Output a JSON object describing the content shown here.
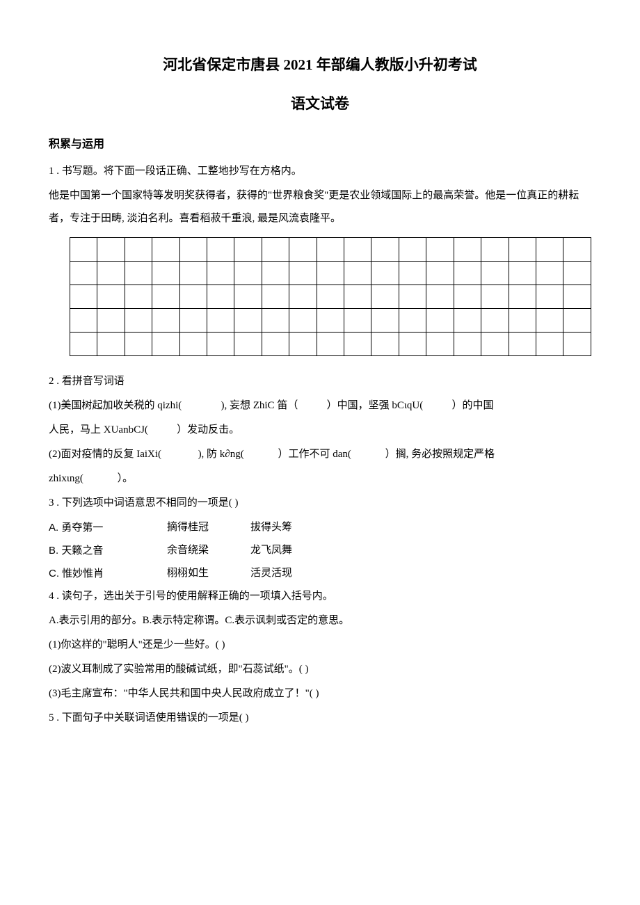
{
  "title": "河北省保定市唐县 2021 年部编人教版小升初考试",
  "subtitle": "语文试卷",
  "section1": "积累与运用",
  "q1": {
    "num": "1 . 书写题。将下面一段话正确、工整地抄写在方格内。",
    "passage": "他是中国第一个国家特等发明奖获得者，获得的\"世界粮食奖\"更是农业领域国际上的最高荣誉。他是一位真正的耕耘者，专注于田畴, 淡泊名利。喜看稻菽千重浪, 最是风流袁隆平。"
  },
  "q2": {
    "num": "2 . 看拼音写词语",
    "line1a": "(1)美国树起加收关税的 qizhi(",
    "line1b": "), 妄想 ZhiC 笛（",
    "line1c": "）中国，坚强 bCιqU(",
    "line1d": "）的中国",
    "line2a": "人民，马上 XUanbCJ(",
    "line2b": "）发动反击。",
    "line3a": "(2)面对疫情的反复 IaiXi(",
    "line3b": "), 防 k∂ng(",
    "line3c": "）工作不可 dan(",
    "line3d": "）搁, 务必按照规定严格",
    "line4a": "zhixιng(",
    "line4b": "）。"
  },
  "q3": {
    "num": "3 . 下列选项中词语意思不相同的一项是(          )",
    "optA": {
      "label": "A. 勇夺第一",
      "w2": "摘得桂冠",
      "w3": "拔得头筹"
    },
    "optB": {
      "label": "B. 天籁之音",
      "w2": "余音绕梁",
      "w3": "龙飞凤舞"
    },
    "optC": {
      "label": "C. 惟妙惟肖",
      "w2": "栩栩如生",
      "w3": "活灵活现"
    }
  },
  "q4": {
    "num": "4 . 读句子，选出关于引号的使用解释正确的一项填入括号内。",
    "options": "A.表示引用的部分。B.表示特定称谓。C.表示讽刺或否定的意思。",
    "s1": "(1)你这样的\"聪明人\"还是少一些好。(               )",
    "s2": "(2)波义耳制成了实验常用的酸碱试纸，即\"石蕊试纸\"。(               )",
    "s3": "(3)毛主席宣布：\"中华人民共和国中央人民政府成立了！\"(                 )"
  },
  "q5": {
    "num": "5 . 下面句子中关联词语使用错误的一项是(          )"
  }
}
